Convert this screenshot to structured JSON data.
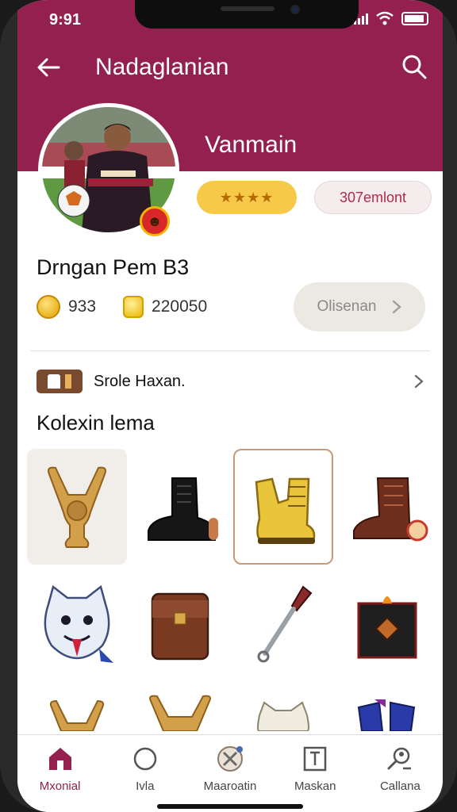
{
  "status_bar": {
    "time": "9:91"
  },
  "header": {
    "title": "Nadaglanian"
  },
  "profile": {
    "name": "Vanmain",
    "rating_stars": "★★★★",
    "element_label": "307emlont",
    "badge_icon": "emblem-icon"
  },
  "player": {
    "heading": "Drngan Pem B3",
    "coins": "933",
    "gems": "220050",
    "action_label": "Olisenan"
  },
  "role": {
    "label": "Srole Haxan."
  },
  "collection": {
    "heading": "Kolexin lema",
    "items": [
      {
        "icon": "trophy-icon",
        "name": "golden-trophy"
      },
      {
        "icon": "boot-icon",
        "name": "black-boot"
      },
      {
        "icon": "boot-icon",
        "name": "yellow-boot",
        "selected": true
      },
      {
        "icon": "boot-icon",
        "name": "brown-boot"
      },
      {
        "icon": "mascot-icon",
        "name": "cat-mascot"
      },
      {
        "icon": "bag-icon",
        "name": "leather-bag"
      },
      {
        "icon": "wand-icon",
        "name": "metal-wand"
      },
      {
        "icon": "chest-icon",
        "name": "fire-chest"
      }
    ]
  },
  "tabs": [
    {
      "label": "Mxonial",
      "icon": "home-icon",
      "active": true
    },
    {
      "label": "Ivla",
      "icon": "circle-icon"
    },
    {
      "label": "Maaroatin",
      "icon": "badge-icon"
    },
    {
      "label": "Maskan",
      "icon": "frame-icon"
    },
    {
      "label": "Callana",
      "icon": "search-person-icon"
    }
  ],
  "colors": {
    "primary": "#94204f",
    "gold": "#f7c948",
    "accent_text": "#b02a4a"
  }
}
